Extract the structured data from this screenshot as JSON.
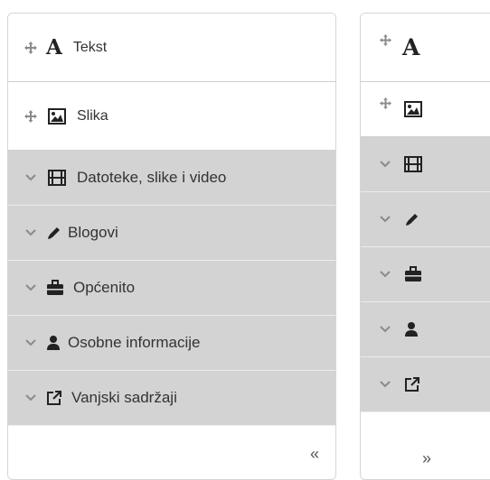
{
  "wide_panel": {
    "blocks": [
      {
        "label": "Tekst",
        "icon": "text-A-icon"
      },
      {
        "label": "Slika",
        "icon": "image-icon"
      }
    ],
    "categories": [
      {
        "label": "Datoteke, slike i video",
        "icon": "film-icon"
      },
      {
        "label": "Blogovi",
        "icon": "pencil-icon"
      },
      {
        "label": "Općenito",
        "icon": "briefcase-icon"
      },
      {
        "label": "Osobne informacije",
        "icon": "user-icon"
      },
      {
        "label": "Vanjski sadržaji",
        "icon": "external-link-icon"
      }
    ],
    "toggle_label": "«"
  },
  "narrow_panel": {
    "toggle_label": "»"
  }
}
